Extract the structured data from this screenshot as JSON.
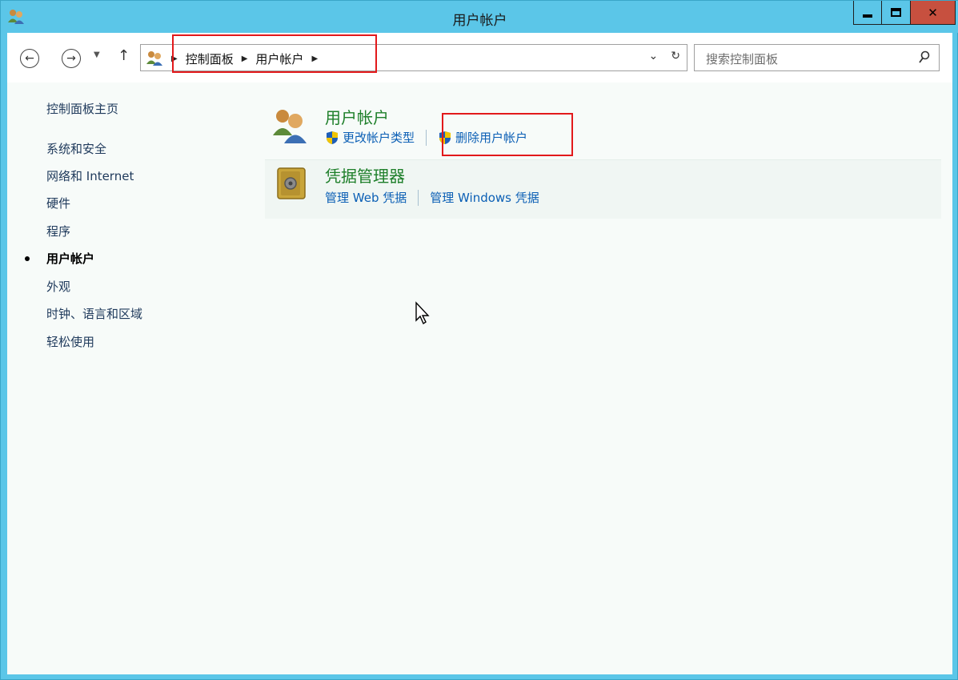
{
  "window": {
    "title": "用户帐户",
    "colors": {
      "chrome": "#5bc6e8",
      "close": "#c7503f",
      "highlight": "#e2191b",
      "link": "#0b5fb5",
      "section_title": "#1e7f2a"
    }
  },
  "addressbar": {
    "crumbs": [
      "控制面板",
      "用户帐户"
    ],
    "search_placeholder": "搜索控制面板"
  },
  "sidebar": {
    "home": "控制面板主页",
    "items": [
      {
        "label": "系统和安全",
        "active": false
      },
      {
        "label": "网络和 Internet",
        "active": false
      },
      {
        "label": "硬件",
        "active": false
      },
      {
        "label": "程序",
        "active": false
      },
      {
        "label": "用户帐户",
        "active": true
      },
      {
        "label": "外观",
        "active": false
      },
      {
        "label": "时钟、语言和区域",
        "active": false
      },
      {
        "label": "轻松使用",
        "active": false
      }
    ]
  },
  "sections": [
    {
      "title": "用户帐户",
      "icon": "users-icon",
      "links": [
        {
          "label": "更改帐户类型",
          "shield": true
        },
        {
          "label": "删除用户帐户",
          "shield": true
        }
      ]
    },
    {
      "title": "凭据管理器",
      "icon": "vault-icon",
      "links": [
        {
          "label": "管理 Web 凭据",
          "shield": false
        },
        {
          "label": "管理 Windows 凭据",
          "shield": false
        }
      ]
    }
  ]
}
